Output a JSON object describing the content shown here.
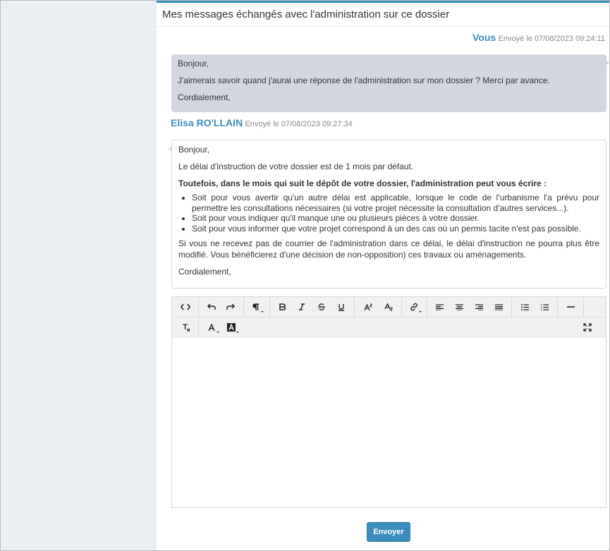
{
  "panel": {
    "title": "Mes messages échangés avec l'administration sur ce dossier"
  },
  "messages": [
    {
      "sender": "Vous",
      "sent": "Envoyé le 07/08/2023 09:24:11",
      "greeting": "Bonjour,",
      "body": "J'aimerais savoir quand j'aurai une réponse de l'administration sur mon dossier ? Merci par avance.",
      "closing": "Cordialement,"
    },
    {
      "sender": "Elisa RO'LLAIN",
      "sent": "Envoyé le 07/08/2023 09:27:34",
      "greeting": "Bonjour,",
      "intro": "Le délai d'instruction de votre dossier est de 1 mois par défaut.",
      "bold": "Toutefois, dans le mois qui suit le dépôt de votre dossier, l'administration peut vous écrire :",
      "bullets": [
        "Soit pour vous avertir qu'un autre délai est applicable, lorsque le code de l'urbanisme l'a prévu pour permettre les consultations nécessaires (si votre projet nécessite la consultation d'autres services...).",
        "Soit pour vous indiquer qu'il manque une ou plusieurs pièces à votre dossier.",
        "Soit pour vous informer que votre projet correspond à un des cas où un permis tacite n'est pas possible."
      ],
      "outro": "Si vous ne recevez pas de courrier de l'administration dans ce délai, le délai d'instruction ne pourra plus être modifié. Vous bénéficierez d'une décision de non-opposition) ces travaux ou aménagements.",
      "closing": "Cordialement,"
    }
  ],
  "editor": {
    "toolbar_icons": [
      "code-view-icon",
      "undo-icon",
      "redo-icon",
      "paragraph-icon",
      "bold-icon",
      "italic-icon",
      "strikethrough-icon",
      "underline-icon",
      "superscript-icon",
      "subscript-icon",
      "link-icon",
      "align-left-icon",
      "align-center-icon",
      "align-right-icon",
      "align-justify-icon",
      "bullet-list-icon",
      "numbered-list-icon",
      "horizontal-rule-icon",
      "clear-format-icon",
      "text-color-icon",
      "background-color-icon",
      "fullscreen-icon"
    ],
    "content": ""
  },
  "actions": {
    "send_label": "Envoyer"
  },
  "colors": {
    "accent": "#3c8dbc",
    "sidebar_bg": "#ebeff4",
    "user_bubble": "#d2d6de"
  }
}
